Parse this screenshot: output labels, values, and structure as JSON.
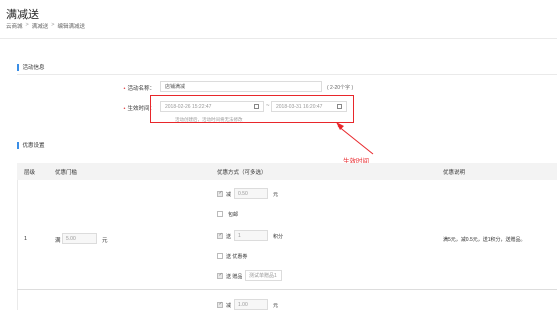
{
  "page": {
    "title": "满减送",
    "breadcrumb": [
      "云商城",
      "满减送",
      "编辑满减送"
    ],
    "breadcrumb_sep": ">"
  },
  "activity_section": {
    "title": "活动信息",
    "name_label": "活动名称：",
    "name_value": "店铺满减",
    "name_hint": "( 2-20个字 )",
    "time_label": "生效时间：",
    "start_time": "2018-02-26 15:22:47",
    "end_time": "2018-03-31 16:20:47",
    "range_sep": "~",
    "time_hint": "活动创建后，活动时间将无法修改"
  },
  "annotation": {
    "label": "生效时间",
    "color": "#e8272b"
  },
  "discount_section": {
    "title": "优惠设置",
    "columns": [
      "层级",
      "优惠门槛",
      "优惠方式（可多选）",
      "优惠说明"
    ],
    "row": {
      "level": "1",
      "threshold_prefix": "满",
      "threshold_value": "5.00",
      "threshold_unit": "元",
      "options": {
        "reduce": {
          "checked": true,
          "prefix": "减",
          "value": "0.50",
          "unit": "元"
        },
        "free_shipping": {
          "checked": false,
          "label": "包邮"
        },
        "points": {
          "checked": true,
          "prefix": "送",
          "value": "1",
          "unit": "积分"
        },
        "coupon": {
          "checked": false,
          "label": "送 优惠券"
        },
        "gift": {
          "checked": true,
          "prefix": "送 赠品",
          "value": "测试单赠品1"
        },
        "next_reduce": {
          "checked": true,
          "prefix": "减",
          "value": "1.00",
          "unit": "元"
        }
      },
      "description": "满5元，减0.5元，送1积分，送赠品。"
    }
  },
  "colors": {
    "accent": "#3a8ee6",
    "annotation_red": "#e8272b"
  }
}
